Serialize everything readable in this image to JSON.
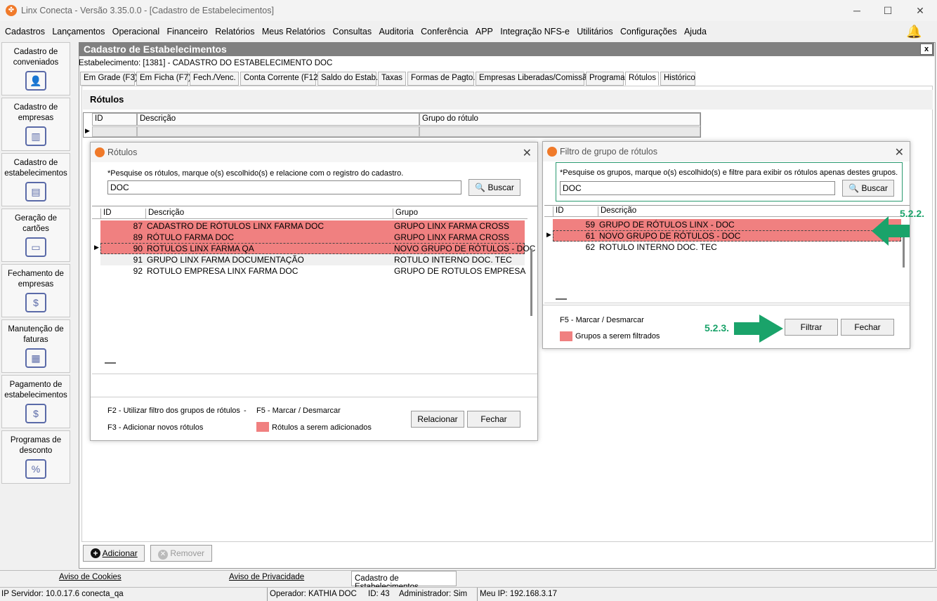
{
  "window": {
    "title": "Linx Conecta - Versão 3.35.0.0 - [Cadastro de Estabelecimentos]",
    "logo_icon": "linx-logo-icon",
    "minimize": "─",
    "maximize": "☐",
    "close": "✕"
  },
  "menu": [
    "Cadastros",
    "Lançamentos",
    "Operacional",
    "Financeiro",
    "Relatórios",
    "Meus Relatórios",
    "Consultas",
    "Auditoria",
    "Conferência",
    "APP",
    "Integração NFS-e",
    "Utilitários",
    "Configurações",
    "Ajuda"
  ],
  "sidebar": [
    {
      "label": "Cadastro de conveniados",
      "icon": "person-icon"
    },
    {
      "label": "Cadastro de empresas",
      "icon": "building-icon"
    },
    {
      "label": "Cadastro de estabelecimentos",
      "icon": "store-icon"
    },
    {
      "label": "Geração de cartões",
      "icon": "card-icon"
    },
    {
      "label": "Fechamento de empresas",
      "icon": "invoice-icon"
    },
    {
      "label": "Manutenção de faturas",
      "icon": "printer-icon"
    },
    {
      "label": "Pagamento de estabelecimentos",
      "icon": "payment-icon"
    },
    {
      "label": "Programas de desconto",
      "icon": "discount-icon"
    }
  ],
  "main": {
    "title": "Cadastro de Estabelecimentos",
    "close": "x",
    "estab": "Estabelecimento: [1381] - CADASTRO DO ESTABELECIMENTO DOC",
    "tabs": [
      "Em Grade (F3)",
      "Em Ficha (F7)",
      "Fech./Venc.",
      "Conta Corrente (F12)",
      "Saldo do Estab.",
      "Taxas",
      "Formas de Pagto.",
      "Empresas Liberadas/Comissão",
      "Programa",
      "Rótulos",
      "Histórico"
    ],
    "active_tab": "Rótulos",
    "section": "Rótulos",
    "grid_headers": [
      "ID",
      "Descrição",
      "Grupo do rótulo"
    ],
    "add_label": "Adicionar",
    "remove_label": "Remover"
  },
  "dlg_rotulos": {
    "title": "Rótulos",
    "hint": "*Pesquise os rótulos, marque o(s) escolhido(s) e relacione com o registro do cadastro.",
    "search_value": "DOC",
    "search_btn": "Buscar",
    "headers": [
      "ID",
      "Descrição",
      "Grupo"
    ],
    "rows": [
      {
        "id": "87",
        "desc": "CADASTRO DE RÓTULOS LINX FARMA DOC",
        "group": "GRUPO LINX  FARMA CROSS",
        "marked": true
      },
      {
        "id": "89",
        "desc": "RÓTULO FARMA DOC",
        "group": "GRUPO LINX  FARMA CROSS",
        "marked": true
      },
      {
        "id": "90",
        "desc": "ROTULOS LINX FARMA QA",
        "group": "NOVO GRUPO DE RÓTULOS - DOC",
        "marked": true
      },
      {
        "id": "91",
        "desc": "GRUPO LINX FARMA DOCUMENTAÇÃO",
        "group": "ROTULO INTERNO DOC. TEC",
        "marked": false
      },
      {
        "id": "92",
        "desc": "ROTULO EMPRESA LINX FARMA DOC",
        "group": "GRUPO DE ROTULOS EMPRESA",
        "marked": false
      }
    ],
    "f2": "F2 - Utilizar filtro dos grupos de rótulos",
    "dash": "-",
    "f5": "F5 - Marcar / Desmarcar",
    "f3": "F3 - Adicionar novos rótulos",
    "legend": "Rótulos a serem adicionados",
    "relacionar": "Relacionar",
    "fechar": "Fechar"
  },
  "dlg_filtro": {
    "title": "Filtro de grupo de rótulos",
    "hint": "*Pesquise os grupos, marque o(s) escolhido(s) e filtre para exibir os rótulos apenas destes grupos.",
    "search_value": "DOC",
    "search_btn": "Buscar",
    "headers": [
      "ID",
      "Descrição"
    ],
    "rows": [
      {
        "id": "59",
        "desc": "GRUPO DE RÓTULOS LINX - DOC",
        "marked": true
      },
      {
        "id": "61",
        "desc": "NOVO GRUPO DE RÓTULOS - DOC",
        "marked": true
      },
      {
        "id": "62",
        "desc": "ROTULO INTERNO DOC. TEC",
        "marked": false
      }
    ],
    "f5": "F5 - Marcar / Desmarcar",
    "legend": "Grupos a serem filtrados",
    "filtrar": "Filtrar",
    "fechar": "Fechar",
    "ann1": "5.2.2.",
    "ann2": "5.2.3."
  },
  "status": {
    "cookies": "Aviso de Cookies",
    "privacy": "Aviso de Privacidade",
    "current": "Cadastro de Estabelecimentos",
    "server": "IP Servidor: 10.0.17.6 conecta_qa",
    "operator": "Operador: KATHIA DOC",
    "id": "ID: 43",
    "admin": "Administrador: Sim",
    "myip": "Meu IP: 192.168.3.17"
  },
  "colors": {
    "marked": "#f08080",
    "annotation": "#1aa36a"
  }
}
